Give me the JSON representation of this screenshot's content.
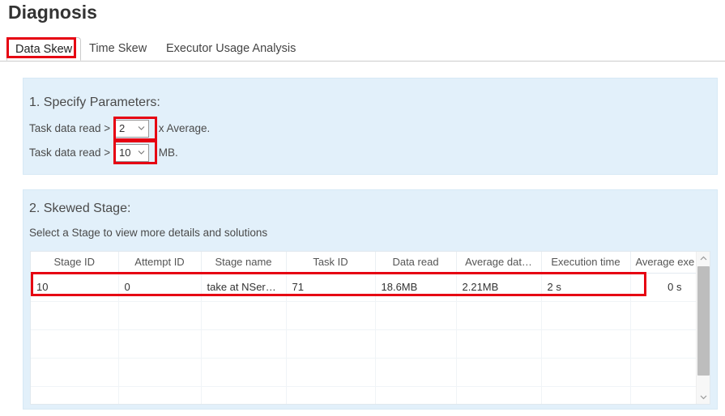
{
  "page": {
    "title": "Diagnosis"
  },
  "colors": {
    "panel_background": "#e2f0fa",
    "annotation_red": "#e60012",
    "text": "#4a4a4a",
    "scrollbar_thumb": "#bdbdbd"
  },
  "tabs": [
    {
      "label": "Data Skew",
      "active": true,
      "highlighted": true
    },
    {
      "label": "Time Skew",
      "active": false,
      "highlighted": false
    },
    {
      "label": "Executor Usage Analysis",
      "active": false,
      "highlighted": false
    }
  ],
  "parameters_section": {
    "heading": "1. Specify Parameters:",
    "rows": [
      {
        "label": "Task data read >",
        "select_value": "2",
        "suffix": "x Average."
      },
      {
        "label": "Task data read >",
        "select_value": "10",
        "suffix": "MB."
      }
    ]
  },
  "stage_section": {
    "heading": "2. Skewed Stage:",
    "subtitle": "Select a Stage to view more details and solutions",
    "table": {
      "columns": [
        "Stage ID",
        "Attempt ID",
        "Stage name",
        "Task ID",
        "Data read",
        "Average dat…",
        "Execution time",
        "Average exe…"
      ],
      "rows": [
        {
          "stage_id": "10",
          "attempt_id": "0",
          "stage_name": "take at NSer…",
          "task_id": "71",
          "data_read": "18.6MB",
          "average_data_read": "2.21MB",
          "execution_time": "2 s",
          "average_execution_time": "0 s",
          "highlighted": true
        },
        {
          "stage_id": "",
          "attempt_id": "",
          "stage_name": "",
          "task_id": "",
          "data_read": "",
          "average_data_read": "",
          "execution_time": "",
          "average_execution_time": "",
          "highlighted": false
        },
        {
          "stage_id": "",
          "attempt_id": "",
          "stage_name": "",
          "task_id": "",
          "data_read": "",
          "average_data_read": "",
          "execution_time": "",
          "average_execution_time": "",
          "highlighted": false
        },
        {
          "stage_id": "",
          "attempt_id": "",
          "stage_name": "",
          "task_id": "",
          "data_read": "",
          "average_data_read": "",
          "execution_time": "",
          "average_execution_time": "",
          "highlighted": false
        },
        {
          "stage_id": "",
          "attempt_id": "",
          "stage_name": "",
          "task_id": "",
          "data_read": "",
          "average_data_read": "",
          "execution_time": "",
          "average_execution_time": "",
          "highlighted": false
        }
      ]
    },
    "scrollbar": {
      "up_icon": "chevron-up-icon",
      "down_icon": "chevron-down-icon"
    }
  },
  "icons": {
    "select_chevron": "chevron-down-icon"
  }
}
